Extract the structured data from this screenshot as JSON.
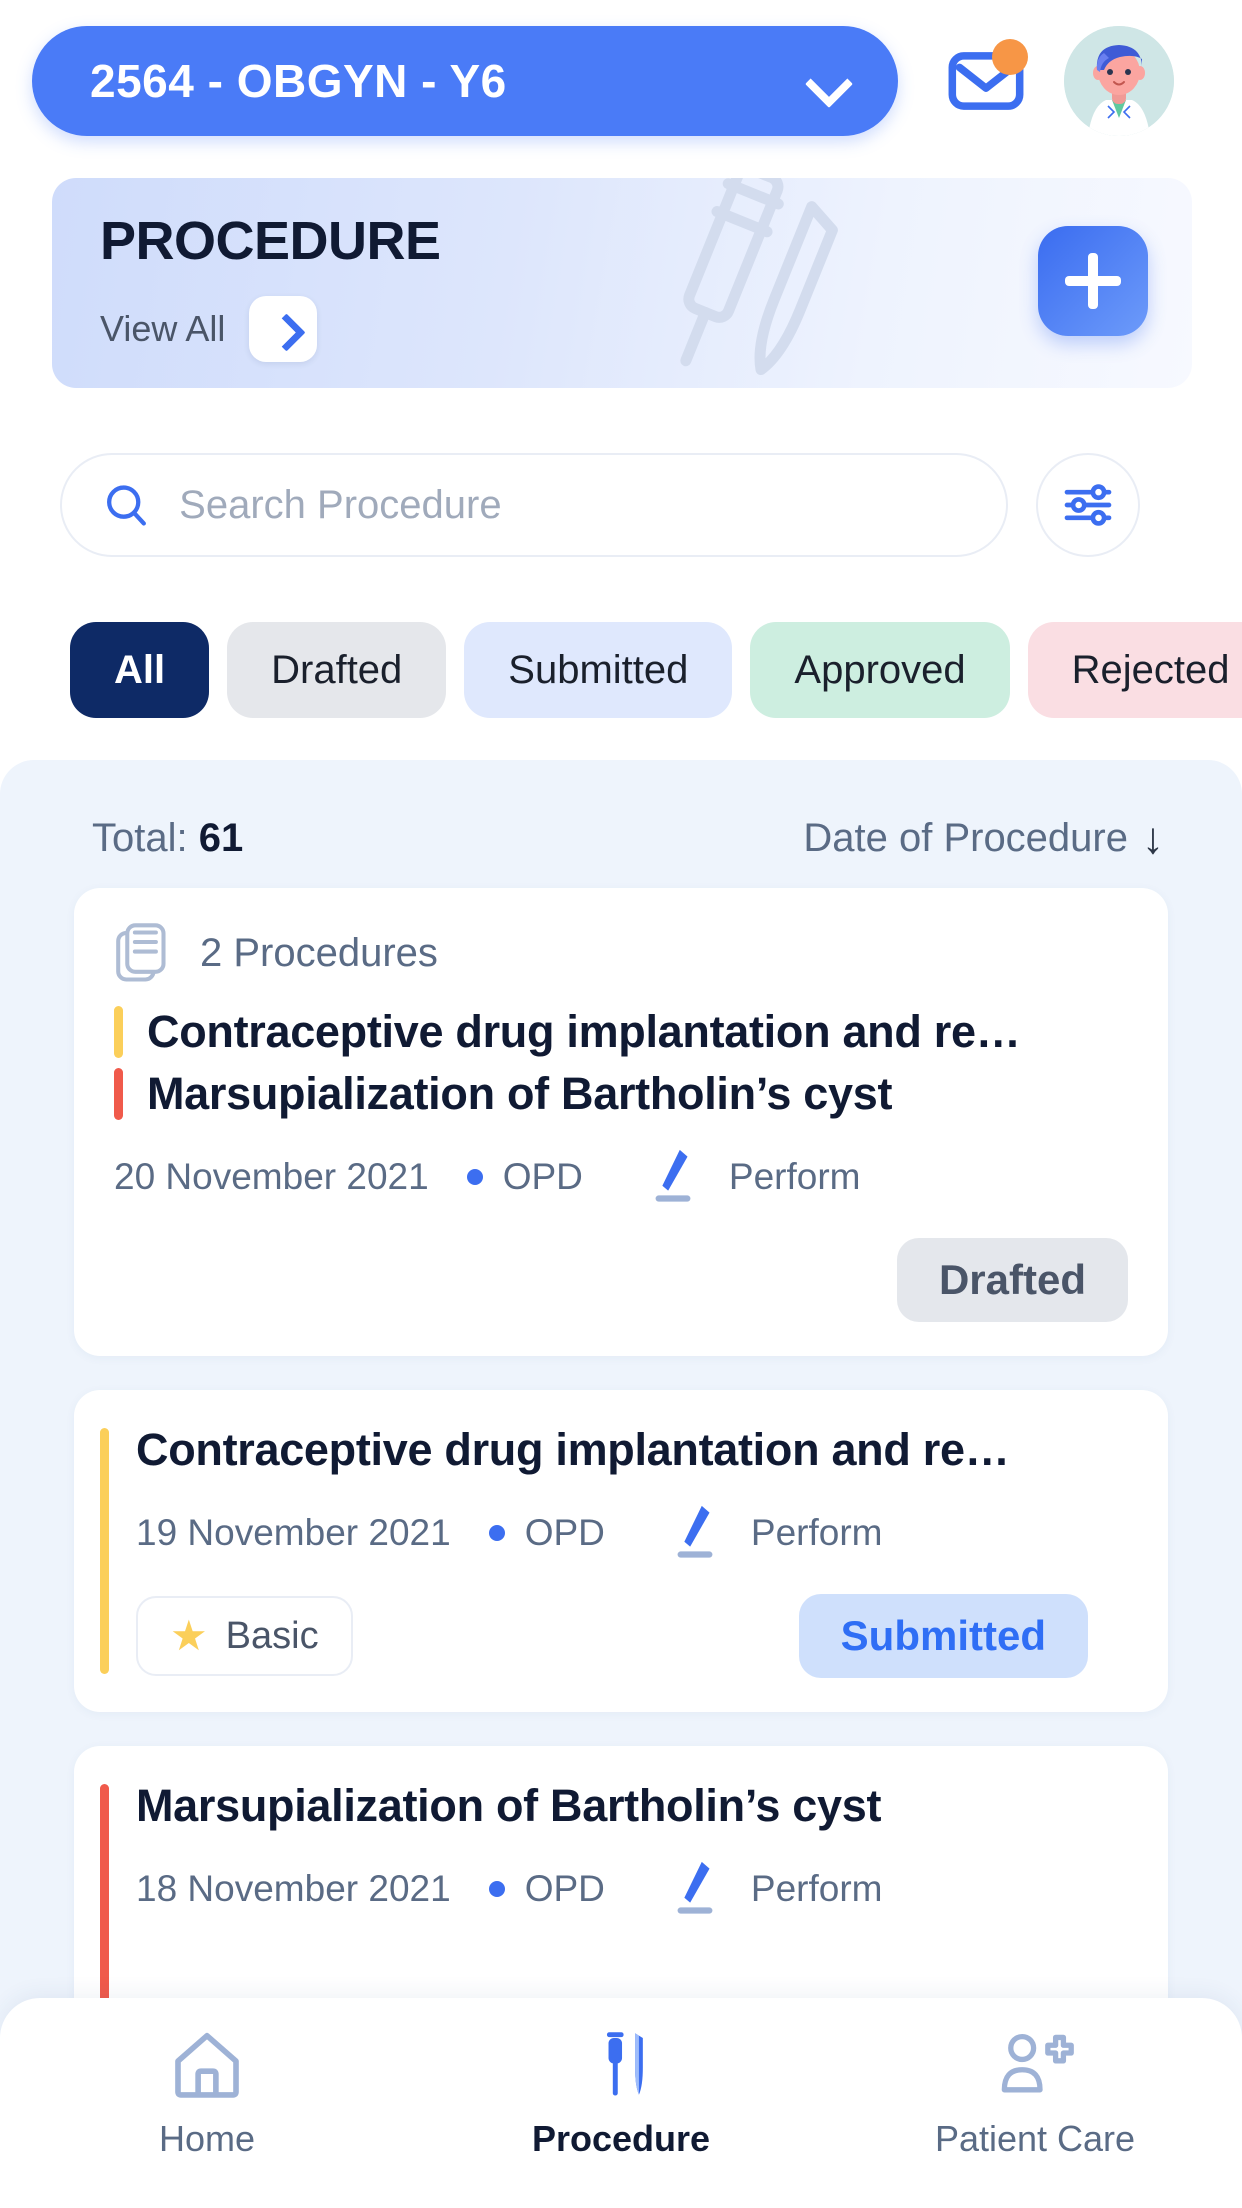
{
  "header": {
    "department_value": "2564 - OBGYN - Y6",
    "chevron_icon": "chevron-down-icon",
    "mail_icon": "mail-icon",
    "mail_badge": "",
    "avatar_icon": "doctor-avatar"
  },
  "hero": {
    "title": "PROCEDURE",
    "view_all_label": "View All",
    "view_all_icon": "chevron-right-icon",
    "add_label": "",
    "add_icon": "plus-icon",
    "watermark_icon": "syringe-scalpel-watermark"
  },
  "search": {
    "placeholder": "Search Procedure",
    "value": "",
    "search_icon": "search-icon",
    "filter_icon": "sliders-filter-icon"
  },
  "filter_chips": [
    {
      "label": "All",
      "state": "active"
    },
    {
      "label": "Drafted",
      "state": "drafted"
    },
    {
      "label": "Submitted",
      "state": "submitted"
    },
    {
      "label": "Approved",
      "state": "approved"
    },
    {
      "label": "Rejected",
      "state": "rejected"
    }
  ],
  "list": {
    "total_label": "Total:",
    "total_count": "61",
    "sort_label": "Date of Procedure",
    "sort_direction_icon": "arrow-down-icon",
    "sort_arrow": "↓"
  },
  "cards": [
    {
      "count_label": "2 Procedures",
      "count_icon": "documents-icon",
      "procedures": [
        {
          "name": "Contraceptive drug implantation and re…",
          "bar_color": "#fbcf5a"
        },
        {
          "name": "Marsupialization of Bartholin’s cyst",
          "bar_color": "#f05a4b"
        }
      ],
      "date": "20 November 2021",
      "setting": "OPD",
      "role": "Perform",
      "role_icon": "scalpel-icon",
      "status": "Drafted",
      "status_style": "drafted",
      "level": null
    },
    {
      "count_label": null,
      "procedures": [
        {
          "name": "Contraceptive drug implantation and re…",
          "bar_color": "#fbcf5a"
        }
      ],
      "date": "19 November 2021",
      "setting": "OPD",
      "role": "Perform",
      "role_icon": "scalpel-icon",
      "status": "Submitted",
      "status_style": "submitted",
      "level": "Basic",
      "level_icon": "star-icon"
    },
    {
      "count_label": null,
      "procedures": [
        {
          "name": "Marsupialization of Bartholin’s cyst",
          "bar_color": "#f05a4b"
        }
      ],
      "date": "18 November 2021",
      "setting": "OPD",
      "role": "Perform",
      "role_icon": "scalpel-icon",
      "status": null,
      "level": null
    }
  ],
  "bottom_nav": [
    {
      "label": "Home",
      "icon": "home-icon",
      "active": false
    },
    {
      "label": "Procedure",
      "icon": "syringe-scalpel-icon",
      "active": true
    },
    {
      "label": "Patient Care",
      "icon": "patient-care-icon",
      "active": false
    }
  ],
  "colors": {
    "primary_blue": "#4a7bf7",
    "dark_navy": "#0e2a66",
    "yellow_bar": "#fbcf5a",
    "red_bar": "#f05a4b",
    "panel_bg": "#eef4fc",
    "badge_orange": "#f79646"
  }
}
